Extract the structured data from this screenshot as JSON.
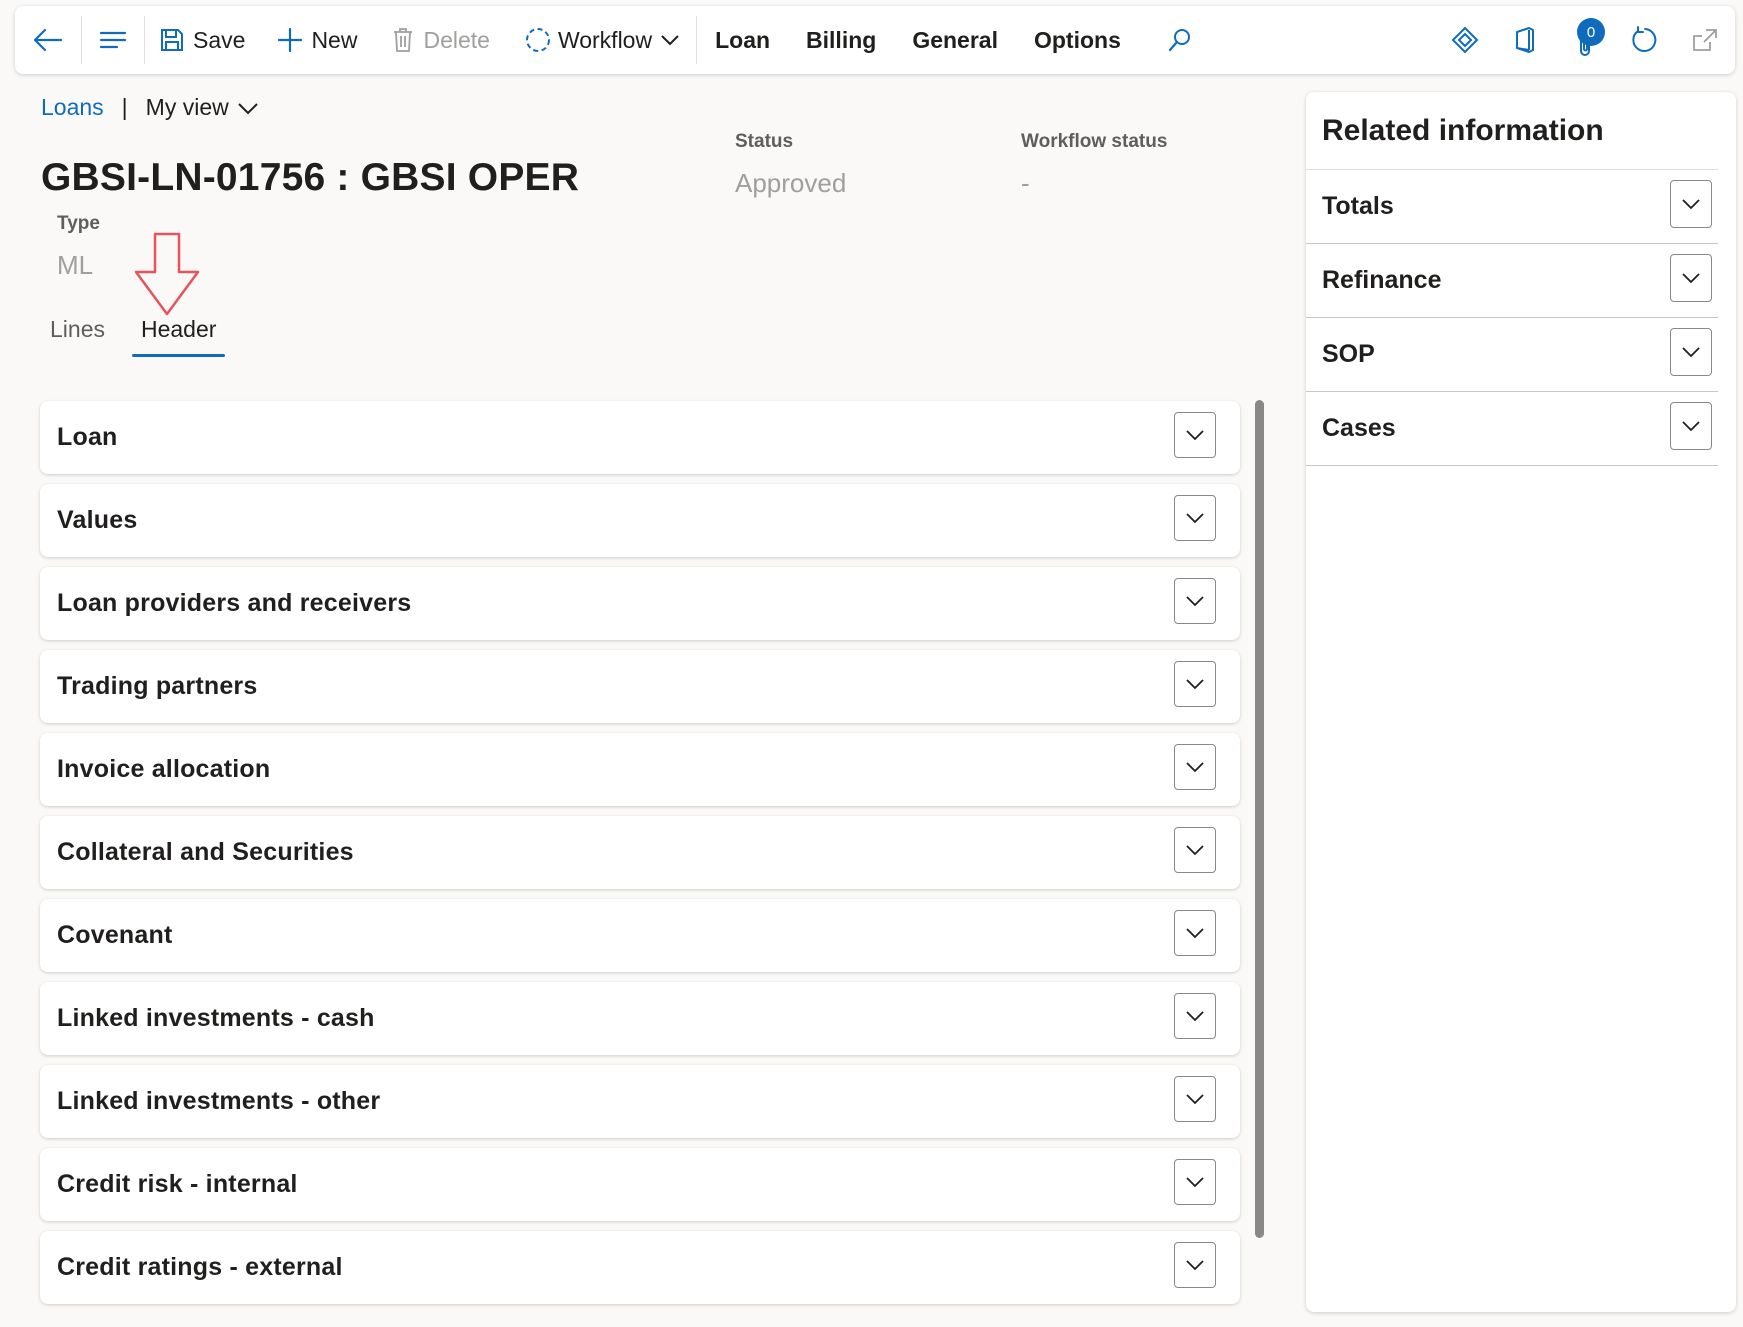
{
  "toolbar": {
    "save_label": "Save",
    "new_label": "New",
    "delete_label": "Delete",
    "workflow_label": "Workflow",
    "tabs": [
      "Loan",
      "Billing",
      "General",
      "Options"
    ],
    "notification_count": "0"
  },
  "breadcrumb": {
    "link": "Loans",
    "separator": "|",
    "view": "My view"
  },
  "header": {
    "title": "GBSI-LN-01756 : GBSI OPER",
    "status_label": "Status",
    "status_value": "Approved",
    "workflow_status_label": "Workflow status",
    "workflow_status_value": "-",
    "type_label": "Type",
    "type_value": "ML"
  },
  "tabs": {
    "lines": "Lines",
    "header": "Header"
  },
  "sections": [
    "Loan",
    "Values",
    "Loan providers and receivers",
    "Trading partners",
    "Invoice allocation",
    "Collateral and Securities",
    "Covenant",
    "Linked investments - cash",
    "Linked investments - other",
    "Credit risk - internal",
    "Credit ratings - external"
  ],
  "related": {
    "title": "Related information",
    "items": [
      "Totals",
      "Refinance",
      "SOP",
      "Cases"
    ]
  },
  "colors": {
    "accent": "#0f6cbd",
    "annotation_arrow": "#e8535b"
  }
}
